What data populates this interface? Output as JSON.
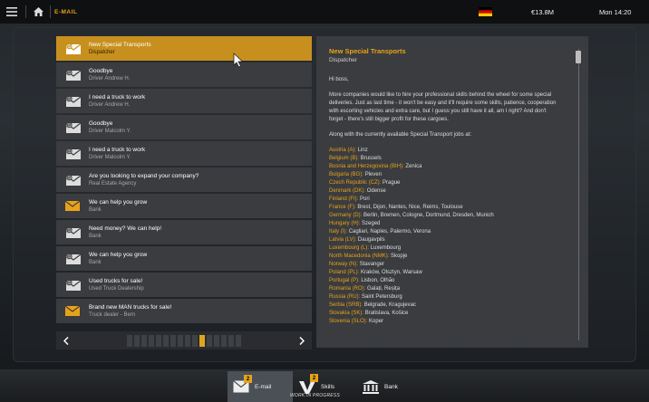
{
  "topbar": {
    "section_title": "E-MAIL",
    "money": "€13.8M",
    "clock": "Mon 14:20"
  },
  "mails": [
    {
      "subject": "New Special Transports",
      "sender": "Dispatcher",
      "icon": "at-envelope-icon",
      "selected": true
    },
    {
      "subject": "Goodbye",
      "sender": "Driver Andrew H.",
      "icon": "at-envelope-icon"
    },
    {
      "subject": "I need a truck to work",
      "sender": "Driver Andrew H.",
      "icon": "at-envelope-icon"
    },
    {
      "subject": "Goodbye",
      "sender": "Driver Malcolm Y.",
      "icon": "at-envelope-icon"
    },
    {
      "subject": "I need a truck to work",
      "sender": "Driver Malcolm Y.",
      "icon": "at-envelope-icon"
    },
    {
      "subject": "Are you looking to expand your company?",
      "sender": "Real Estate Agency",
      "icon": "at-envelope-icon"
    },
    {
      "subject": "We can help you grow",
      "sender": "Bank",
      "icon": "envelope-unread-icon"
    },
    {
      "subject": "Need money? We can help!",
      "sender": "Bank",
      "icon": "at-envelope-icon"
    },
    {
      "subject": "We can help you grow",
      "sender": "Bank",
      "icon": "at-envelope-icon"
    },
    {
      "subject": "Used trucks for sale!",
      "sender": "Used Truck Dealership",
      "icon": "at-envelope-icon"
    },
    {
      "subject": "Brand new MAN trucks for sale!",
      "sender": "Truck dealer - Bern",
      "icon": "envelope-unread-icon"
    }
  ],
  "pager": {
    "page_count": 16,
    "current_page": 11
  },
  "detail": {
    "subject": "New Special Transports",
    "sender": "Dispatcher",
    "greeting": "Hi boss,",
    "paragraph1": "More companies would like to hire your professional skills behind the wheel for some special deliveries. Just as last time - it won't be easy and it'll require some skills, patience, cooperation with escorting vehicles and extra care, but I guess you still have it all, am I right? And don't forget - there's still bigger profit for these cargoes.",
    "paragraph2": "Along with the currently available Special Transport jobs at:",
    "countries": [
      {
        "country": "Austria (A):",
        "cities": "Linz"
      },
      {
        "country": "Belgium (B):",
        "cities": "Brussels"
      },
      {
        "country": "Bosnia and Herzegovina (BIH):",
        "cities": "Zenica"
      },
      {
        "country": "Bulgaria (BG):",
        "cities": "Pleven"
      },
      {
        "country": "Czech Republic (CZ):",
        "cities": "Prague"
      },
      {
        "country": "Denmark (DK):",
        "cities": "Odense"
      },
      {
        "country": "Finland (FI):",
        "cities": "Pori"
      },
      {
        "country": "France (F):",
        "cities": "Brest, Dijon, Nantes, Nice, Reims, Toulouse"
      },
      {
        "country": "Germany (D):",
        "cities": "Berlin, Bremen, Cologne, Dortmund, Dresden, Munich"
      },
      {
        "country": "Hungary (H):",
        "cities": "Szeged"
      },
      {
        "country": "Italy (I):",
        "cities": "Cagliari, Naples, Palermo, Verona"
      },
      {
        "country": "Latvia (LV):",
        "cities": "Daugavpils"
      },
      {
        "country": "Luxembourg (L):",
        "cities": "Luxembourg"
      },
      {
        "country": "North Macedonia (NMK):",
        "cities": "Skopje"
      },
      {
        "country": "Norway (N):",
        "cities": "Stavanger"
      },
      {
        "country": "Poland (PL):",
        "cities": "Kraków, Olsztyn, Warsaw"
      },
      {
        "country": "Portugal (P):",
        "cities": "Lisbon, Olhão"
      },
      {
        "country": "Romania (RO):",
        "cities": "Galați, Reșița"
      },
      {
        "country": "Russia (RU):",
        "cities": "Saint Petersburg"
      },
      {
        "country": "Serbia (SRB):",
        "cities": "Belgrade, Kragujevac"
      },
      {
        "country": "Slovakia (SK):",
        "cities": "Bratislava, Košice"
      },
      {
        "country": "Slovenia (SLO):",
        "cities": "Koper"
      }
    ]
  },
  "dock": {
    "email_label": "E-mail",
    "email_badge": "2",
    "skills_label": "Skills",
    "skills_badge": "2",
    "bank_label": "Bank",
    "wip_label": "WORK IN PROGRESS"
  },
  "colors": {
    "accent": "#e8a21a",
    "selected_row": "#c7901e",
    "row": "#3a3c3f"
  }
}
